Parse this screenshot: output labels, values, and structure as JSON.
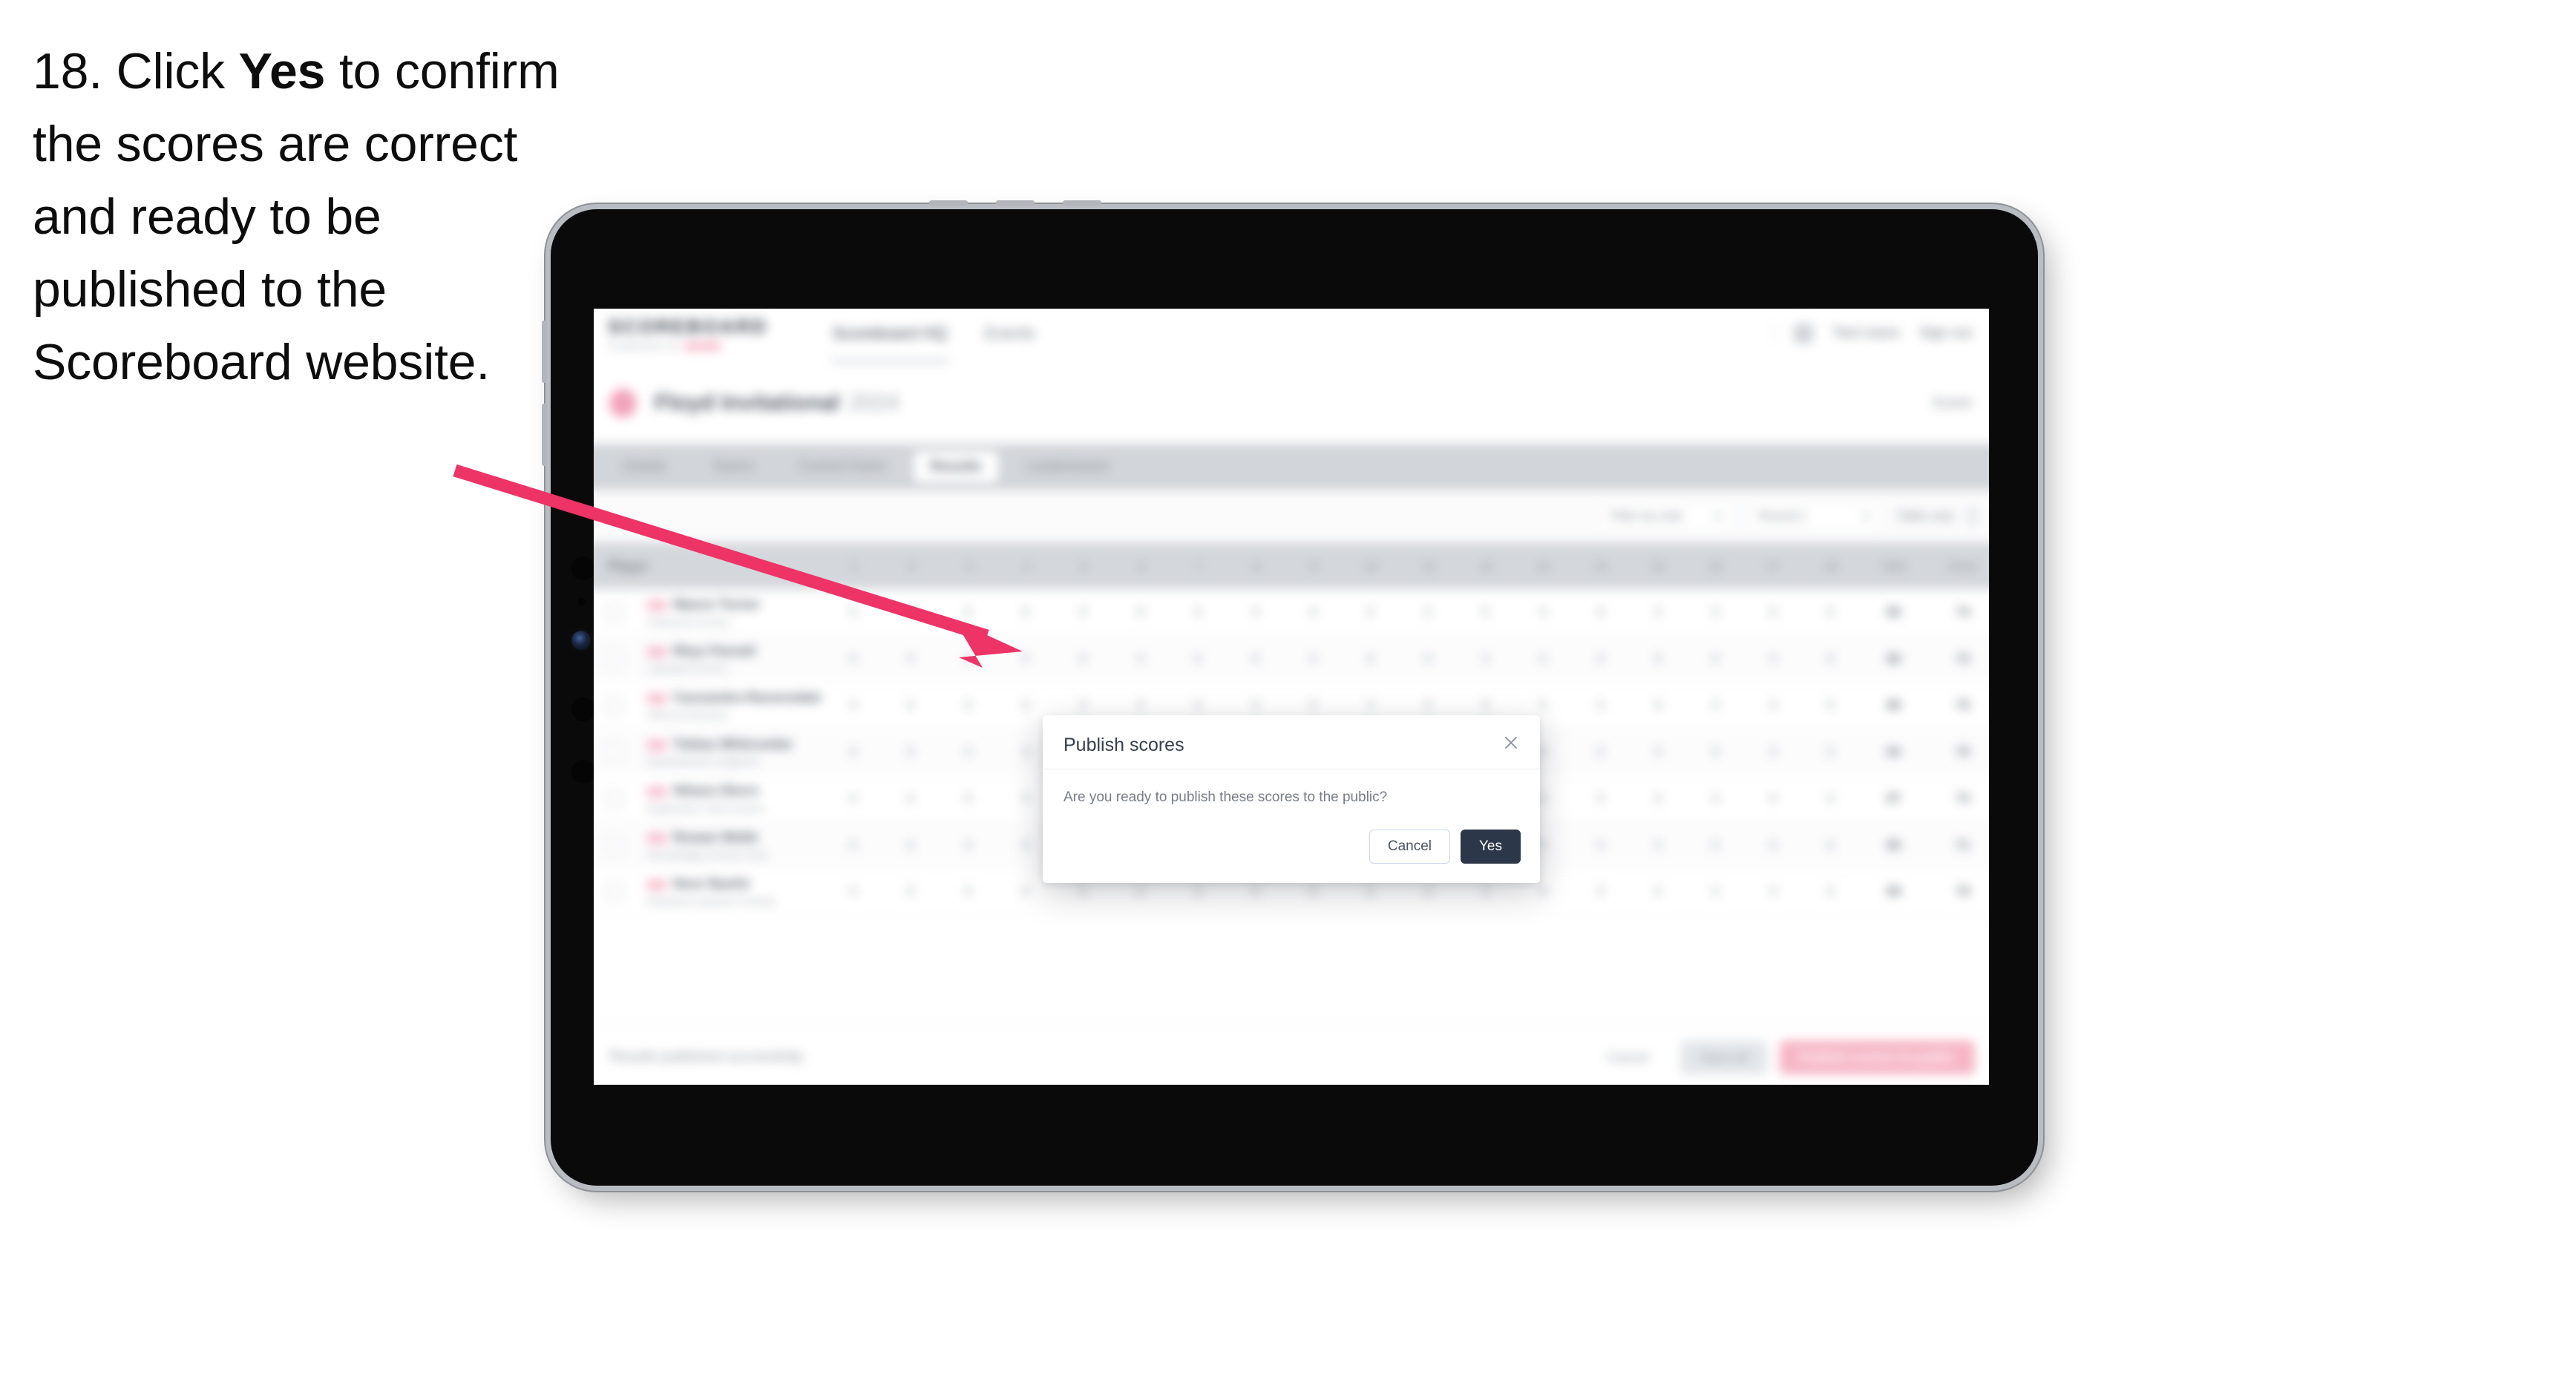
{
  "caption": {
    "number": "18.",
    "pre": "Click ",
    "bold": "Yes",
    "post": " to confirm the scores are correct and ready to be published to the Scoreboard website."
  },
  "annotation": {
    "arrow_color": "#ee3366",
    "arrow_name": "pointer-arrow"
  },
  "app": {
    "brand": {
      "main": "SCOREBOARD",
      "sub_plain": "POWERED BY ",
      "sub_accent": "SPORT"
    },
    "nav_links": [
      {
        "label": "Scoreboard HQ",
        "active": true
      },
      {
        "label": "Events",
        "active": false
      }
    ],
    "nav_right": {
      "icon": "bell-icon",
      "user": "Test Users",
      "signout": "Sign out"
    },
    "event": {
      "logo": "club-crest-icon",
      "title": "Floyd Invitational",
      "year": "2024",
      "right": "Event",
      "right_chev": "chevron-right-icon"
    },
    "tabs": [
      {
        "label": "Details",
        "active": false
      },
      {
        "label": "Teams",
        "active": false
      },
      {
        "label": "Control Panel",
        "active": false
      },
      {
        "label": "Results",
        "active": true
      },
      {
        "label": "Leaderboard",
        "active": false
      }
    ],
    "toolbar": {
      "search_placeholder": "Search",
      "selects": [
        {
          "label": "Filter by club",
          "icon": "chevron-down-icon"
        },
        {
          "label": "Round 1",
          "icon": "chevron-down-icon"
        }
      ],
      "toggle_label": "Table only",
      "toggle_icon": "toggle-icon"
    },
    "table": {
      "header_player": "Player",
      "header_numbers": [
        "1",
        "2",
        "3",
        "4",
        "5",
        "6",
        "7",
        "8",
        "9",
        "10",
        "11",
        "12",
        "13",
        "14",
        "15",
        "16",
        "17",
        "18"
      ],
      "header_wide": [
        "Total",
        "Score"
      ],
      "rows": [
        {
          "name": "Maeve Turner",
          "club": "Oakwood Archery",
          "badge": "flag-badge",
          "scores": [
            "9",
            "8",
            "9",
            "8",
            "9",
            "8",
            "9",
            "9",
            "8",
            "9",
            "9",
            "8",
            "9",
            "8",
            "9",
            "9",
            "8",
            "9"
          ],
          "total": "86",
          "score": "74",
          "pills": [
            "158",
            "122"
          ]
        },
        {
          "name": "Rhys Parnell",
          "club": "Lakeside Archers",
          "badge": "flag-badge",
          "scores": [
            "8",
            "9",
            "8",
            "9",
            "8",
            "9",
            "8",
            "8",
            "9",
            "8",
            "8",
            "9",
            "8",
            "9",
            "8",
            "8",
            "9",
            "8"
          ],
          "total": "86",
          "score": "72",
          "pills": [
            "154",
            "119"
          ]
        },
        {
          "name": "Cassandra Ravensdale",
          "club": "Hillcrest Bowmen",
          "badge": "flag-badge",
          "scores": [
            "9",
            "9",
            "8",
            "8",
            "9",
            "9",
            "8",
            "9",
            "8",
            "9",
            "8",
            "8",
            "9",
            "9",
            "8",
            "9",
            "8",
            "8"
          ],
          "total": "88",
          "score": "75",
          "pills": [
            "160",
            "125"
          ]
        },
        {
          "name": "Tobias Whitcombe",
          "club": "Ravenswood Longbows",
          "badge": "flag-badge",
          "scores": [
            "8",
            "8",
            "9",
            "9",
            "8",
            "8",
            "9",
            "8",
            "9",
            "8",
            "9",
            "9",
            "8",
            "8",
            "9",
            "8",
            "9",
            "9"
          ],
          "total": "84",
          "score": "70",
          "pills": [
            "149",
            "116"
          ]
        },
        {
          "name": "Nihara Okoro",
          "club": "Brightwater Field Archers",
          "badge": "flag-badge",
          "scores": [
            "9",
            "8",
            "8",
            "9",
            "9",
            "8",
            "8",
            "9",
            "9",
            "8",
            "8",
            "9",
            "9",
            "8",
            "8",
            "9",
            "9",
            "8"
          ],
          "total": "87",
          "score": "73",
          "pills": [
            "156",
            "121"
          ]
        },
        {
          "name": "Rowan Webb",
          "club": "Stonebridge Archery Club",
          "badge": "flag-badge",
          "scores": [
            "8",
            "9",
            "9",
            "8",
            "8",
            "9",
            "9",
            "8",
            "8",
            "9",
            "9",
            "8",
            "8",
            "9",
            "9",
            "8",
            "8",
            "9"
          ],
          "total": "85",
          "score": "71",
          "pills": [
            "152",
            "118"
          ]
        },
        {
          "name": "Noor Bashir",
          "club": "Windmere Bowmen Society",
          "badge": "flag-badge",
          "scores": [
            "9",
            "9",
            "9",
            "8",
            "9",
            "8",
            "9",
            "9",
            "8",
            "8",
            "9",
            "9",
            "8",
            "9",
            "8",
            "9",
            "9",
            "8"
          ],
          "total": "89",
          "score": "76",
          "pills": [
            "162",
            "127"
          ]
        }
      ]
    },
    "footer": {
      "note": "Results published successfully.",
      "link": "Cancel",
      "grey_button": "Save all",
      "pink_button": "Publish scores to public"
    }
  },
  "modal": {
    "title": "Publish scores",
    "close_icon": "close-icon",
    "body": "Are you ready to publish these scores to the public?",
    "cancel_label": "Cancel",
    "yes_label": "Yes",
    "yes_color": "#2c3749"
  }
}
